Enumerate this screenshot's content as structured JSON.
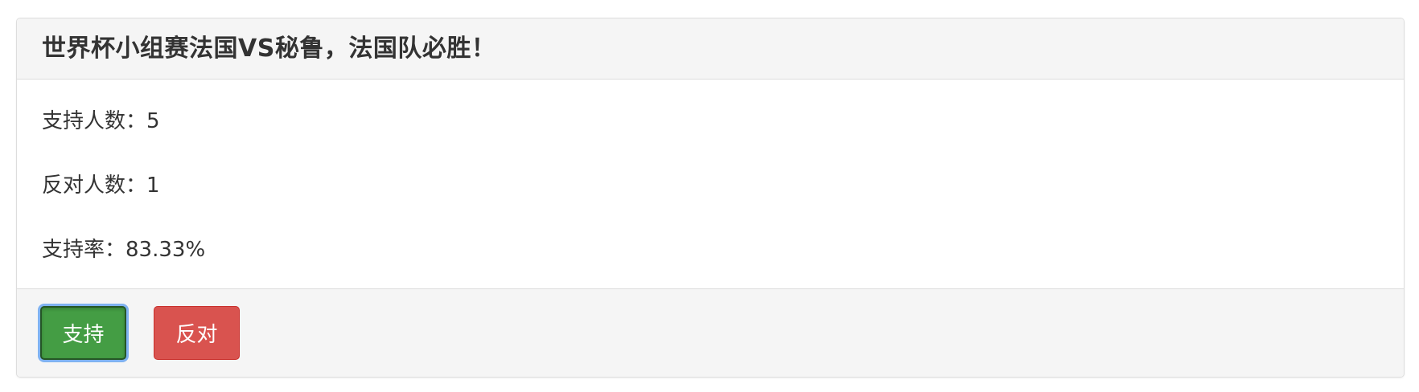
{
  "panel": {
    "title": "世界杯小组赛法国VS秘鲁，法国队必胜！"
  },
  "stats": {
    "support_label": "支持人数：",
    "support_count": "5",
    "oppose_label": "反对人数：",
    "oppose_count": "1",
    "rate_label": "支持率：",
    "rate_value": "83.33%"
  },
  "buttons": {
    "support_label": "支持",
    "oppose_label": "反对"
  },
  "colors": {
    "support_button": "#449d44",
    "oppose_button": "#d9534f",
    "panel_header_bg": "#f5f5f5",
    "border": "#dddddd"
  }
}
